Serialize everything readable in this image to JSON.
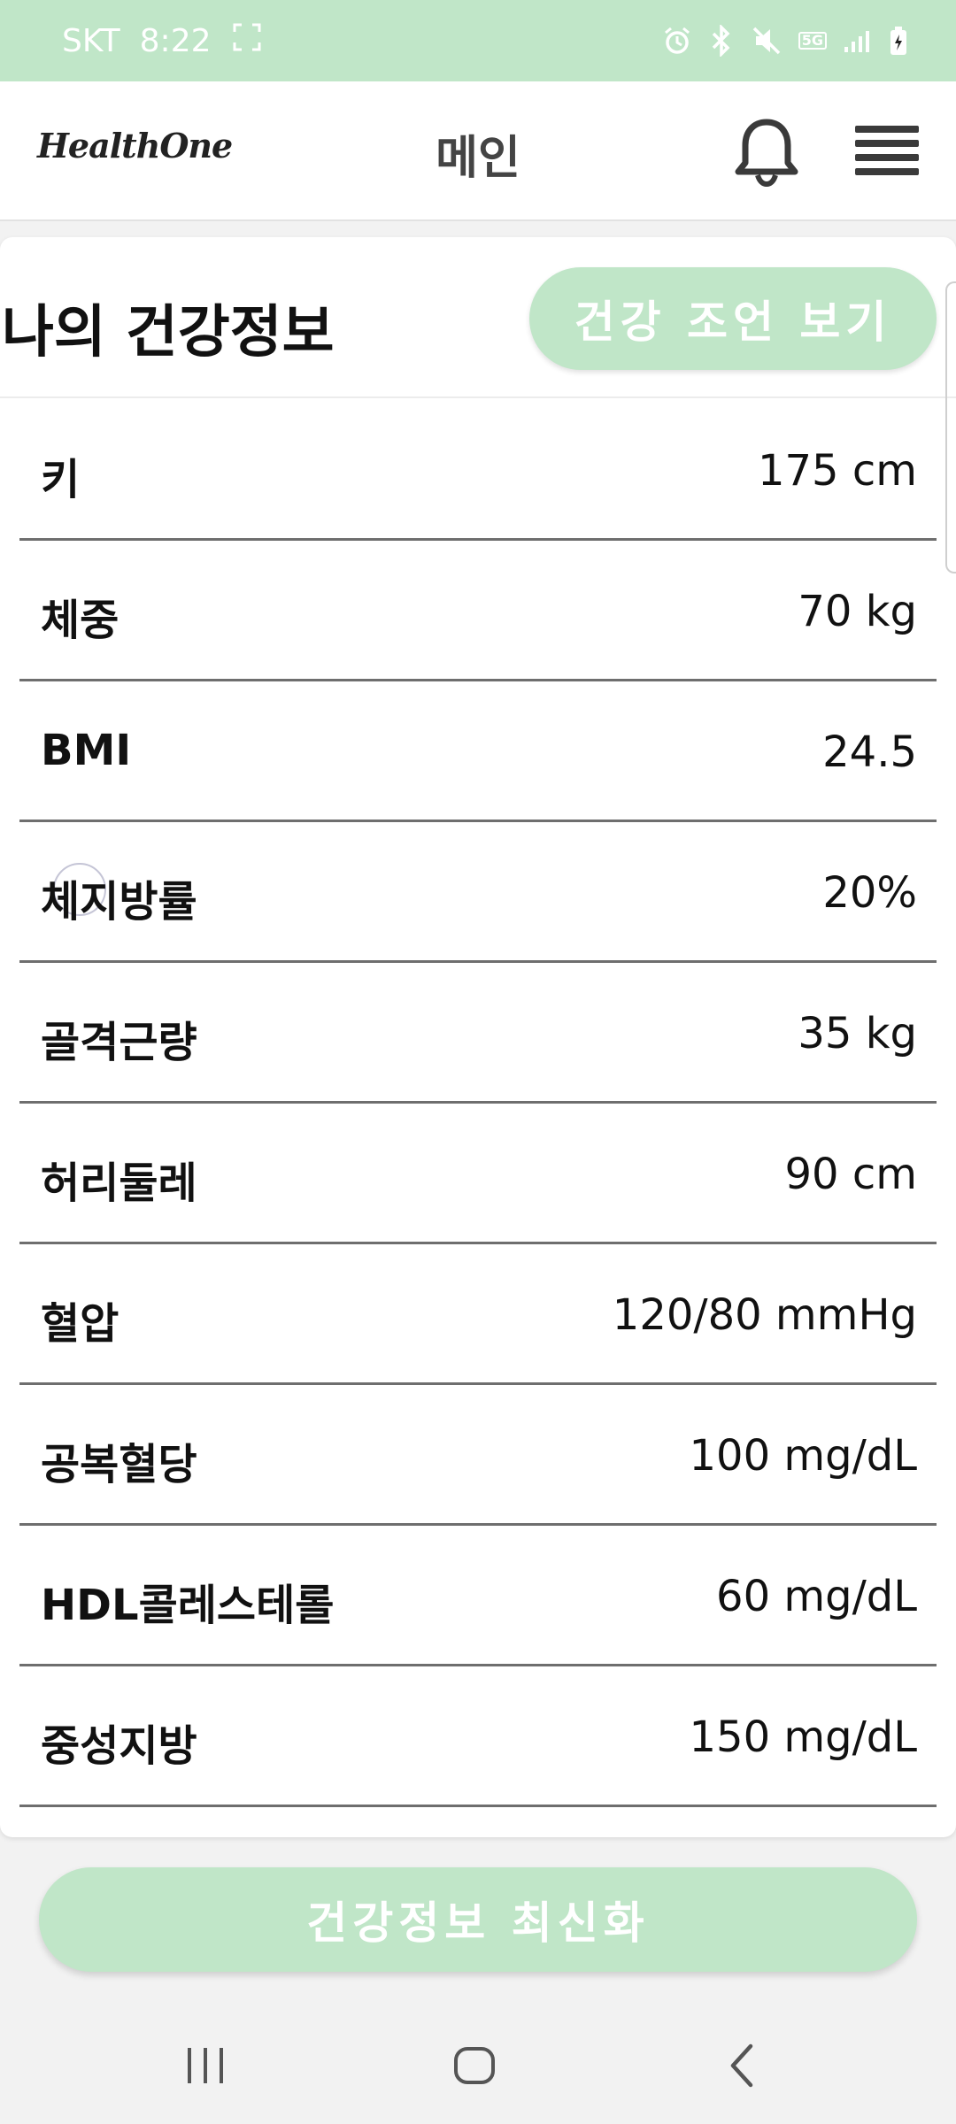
{
  "status_bar": {
    "carrier": "SKT",
    "time": "8:22",
    "network": "5G"
  },
  "header": {
    "logo": "HealthOne",
    "title": "메인",
    "icons": [
      "bell-icon",
      "menu-icon"
    ]
  },
  "card": {
    "title": "나의 건강정보",
    "advice_button_label": "건강 조언 보기"
  },
  "health_info": [
    {
      "label": "키",
      "value": "175 cm"
    },
    {
      "label": "체중",
      "value": "70 kg"
    },
    {
      "label": "BMI",
      "value": "24.5"
    },
    {
      "label": "체지방률",
      "value": "20%"
    },
    {
      "label": "골격근량",
      "value": "35 kg"
    },
    {
      "label": "허리둘레",
      "value": "90 cm"
    },
    {
      "label": "혈압",
      "value": "120/80 mmHg"
    },
    {
      "label": "공복혈당",
      "value": "100 mg/dL"
    },
    {
      "label": "HDL콜레스테롤",
      "value": "60 mg/dL"
    },
    {
      "label": "중성지방",
      "value": "150 mg/dL"
    }
  ],
  "refresh_button_label": "건강정보 최신화",
  "nav": [
    "recent-apps-icon",
    "home-icon",
    "back-icon"
  ],
  "colors": {
    "accent": "#c0e6c8",
    "text": "#111111",
    "divider": "#6e6e6e"
  }
}
